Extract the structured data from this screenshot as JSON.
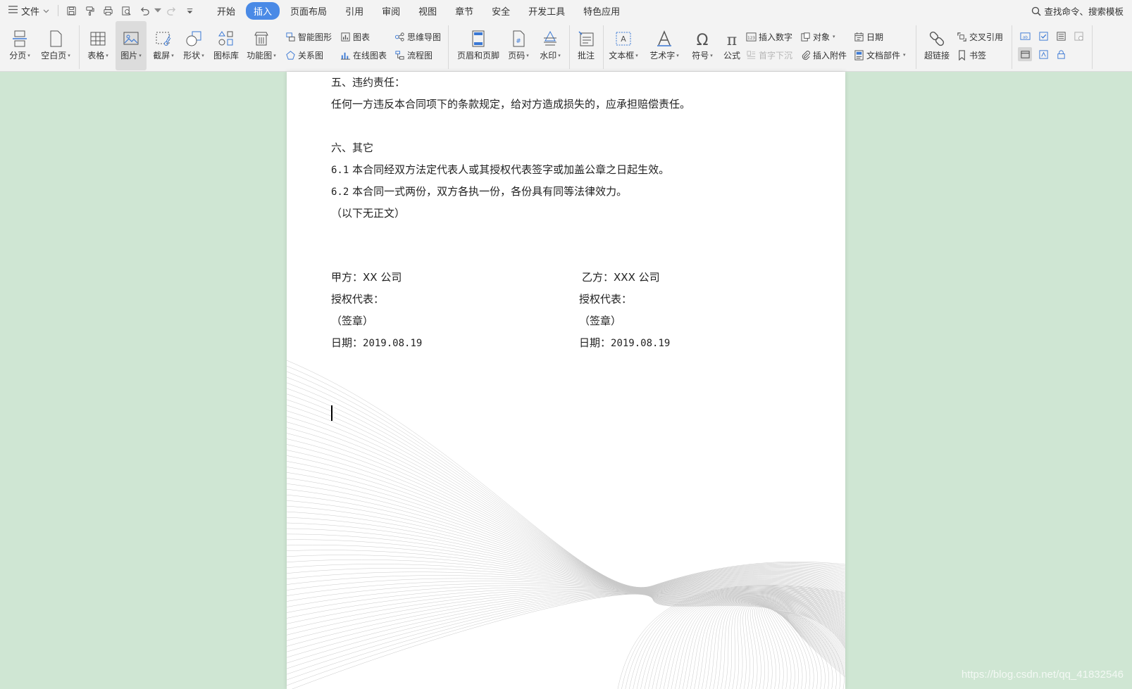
{
  "menubar": {
    "file_label": "文件",
    "tabs": [
      {
        "label": "开始"
      },
      {
        "label": "插入"
      },
      {
        "label": "页面布局"
      },
      {
        "label": "引用"
      },
      {
        "label": "审阅"
      },
      {
        "label": "视图"
      },
      {
        "label": "章节"
      },
      {
        "label": "安全"
      },
      {
        "label": "开发工具"
      },
      {
        "label": "特色应用"
      }
    ],
    "active_tab": "插入",
    "search_label": "查找命令、搜索模板"
  },
  "ribbon": {
    "page_break": "分页",
    "blank_page": "空白页",
    "table": "表格",
    "picture": "图片",
    "screenshot": "截屏",
    "shapes": "形状",
    "icon_library": "图标库",
    "function_chart": "功能图",
    "smart_art": "智能图形",
    "chart": "图表",
    "mind_map": "思维导图",
    "relation_chart": "关系图",
    "online_chart": "在线图表",
    "flowchart": "流程图",
    "header_footer": "页眉和页脚",
    "page_number": "页码",
    "watermark": "水印",
    "comment": "批注",
    "text_box": "文本框",
    "word_art": "艺术字",
    "symbol": "符号",
    "formula": "公式",
    "insert_number": "插入数字",
    "drop_cap": "首字下沉",
    "object": "对象",
    "attachment": "插入附件",
    "date": "日期",
    "doc_parts": "文档部件",
    "hyperlink": "超链接",
    "cross_ref": "交叉引用",
    "bookmark": "书签"
  },
  "document": {
    "section5_title": "五、违约责任：",
    "section5_body": "任何一方违反本合同项下的条款规定，给对方造成损失的，应承担赔偿责任。",
    "section6_title": "六、其它",
    "clause_6_1_num": "6.1",
    "clause_6_1_text": "本合同经双方法定代表人或其授权代表签字或加盖公章之日起生效。",
    "clause_6_2_num": "6.2",
    "clause_6_2_text": "本合同一式两份，双方各执一份，各份具有同等法律效力。",
    "no_more_text": "（以下无正文）",
    "party_a": {
      "name_label": "甲方：",
      "name_value": "XX 公司",
      "rep_label": "授权代表：",
      "seal_label": "（签章）",
      "date_label": "日期：",
      "date_value": "2019.08.19"
    },
    "party_b": {
      "name_label": "乙方：",
      "name_value": "XXX 公司",
      "rep_label": "授权代表：",
      "seal_label": "（签章）",
      "date_label": "日期：",
      "date_value": "2019.08.19"
    }
  },
  "watermark_text": "https://blog.csdn.net/qq_41832546",
  "colors": {
    "active_tab": "#4a8ae6",
    "background": "#cfe6d3",
    "icon_blue": "#3a78d4"
  }
}
